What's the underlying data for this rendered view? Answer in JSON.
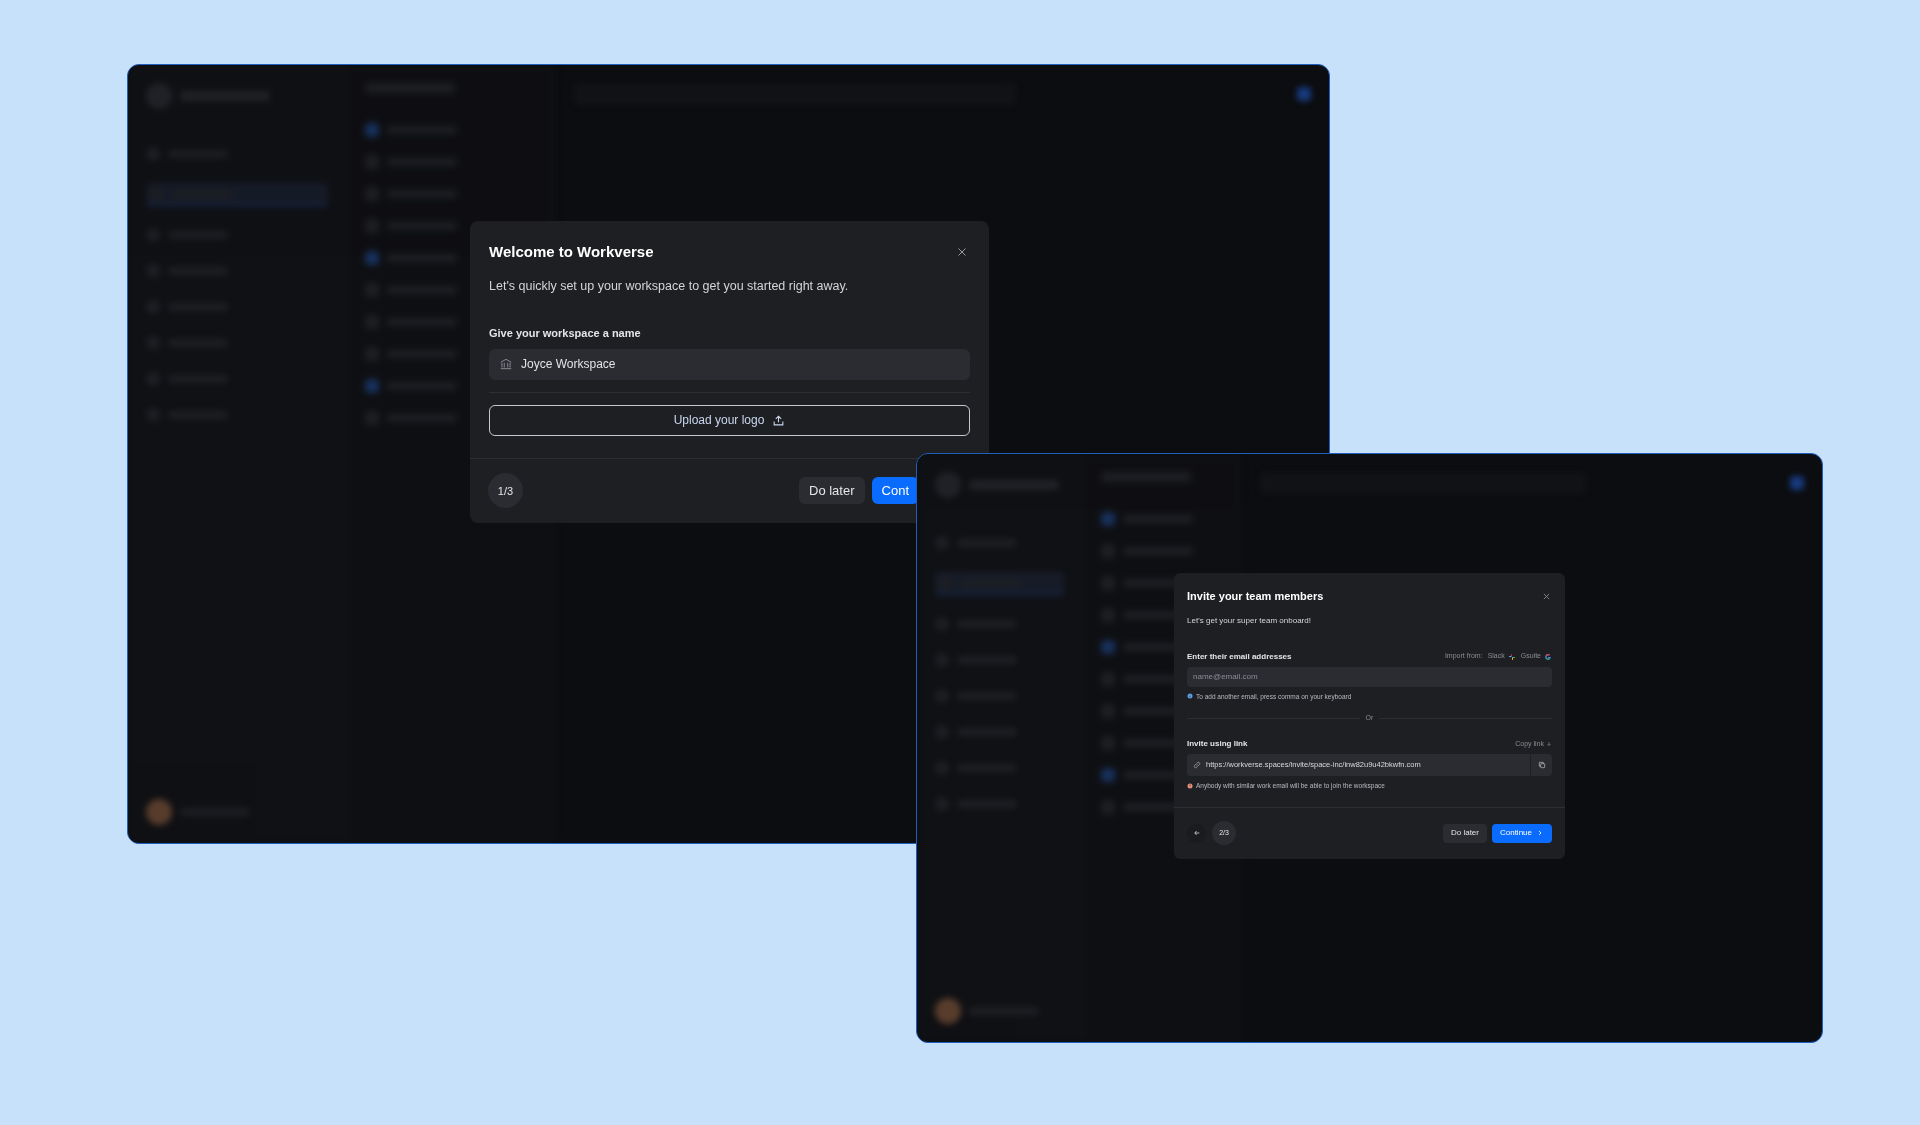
{
  "welcome_window": {
    "modal": {
      "title": "Welcome to Workverse",
      "subtitle": "Let's quickly set up your workspace to get you started right away.",
      "field_label": "Give your workspace a name",
      "field_value": "Joyce Workspace",
      "upload_button": "Upload your logo",
      "step": "1/3",
      "buttons": [
        {
          "label": "Do later",
          "kind": "secondary"
        },
        {
          "label": "Cont",
          "kind": "primary"
        }
      ]
    }
  },
  "invite_window": {
    "modal": {
      "title": "Invite your team members",
      "subtitle": "Let’s get your super team onboard!",
      "email_label": "Enter their email addresses",
      "import_label": "Import from:",
      "import_sources": [
        {
          "label": "Slack",
          "kind": "slack"
        },
        {
          "label": "Gsuite",
          "kind": "google"
        }
      ],
      "email_placeholder": "name@email.com",
      "email_hint": "To add another email, press comma on your keyboard",
      "divider": "Or",
      "link_label": "Invite using link",
      "copy_link": "Copy link",
      "link_value": "https://workverse.spaces/invite/space-inc/inw82u9u42bkwfn.com",
      "warning": "Anybody with similar work email will be able to join the workspace",
      "step": "2/3",
      "buttons": [
        {
          "label": "Do later",
          "kind": "secondary"
        },
        {
          "label": "Continue",
          "kind": "primary"
        }
      ]
    }
  }
}
